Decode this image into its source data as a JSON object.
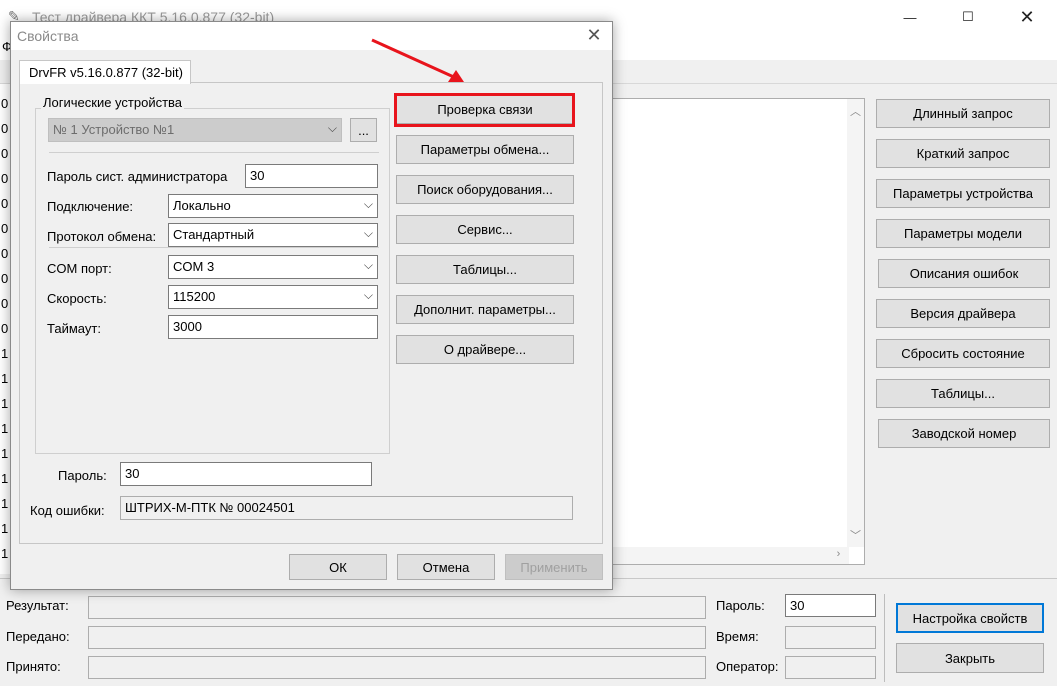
{
  "main_window": {
    "title": "Тест драйвера ККТ 5.16.0.877 (32-bit)",
    "menu_first_letter": "Ф",
    "gutter_numbers": [
      "0",
      "0",
      "0",
      "0",
      "0",
      "0",
      "0",
      "0",
      "0",
      "0",
      "1",
      "1",
      "1",
      "1",
      "1",
      "1",
      "1",
      "1",
      "1"
    ],
    "right_buttons": [
      "Длинный запрос",
      "Краткий запрос",
      "Параметры устройства",
      "Параметры модели",
      "Описания ошибок",
      "Версия драйвера",
      "Сбросить состояние",
      "Таблицы...",
      "Заводской номер"
    ],
    "bottom": {
      "result_label": "Результат:",
      "sent_label": "Передано:",
      "received_label": "Принято:",
      "password_label": "Пароль:",
      "password_value": "30",
      "time_label": "Время:",
      "operator_label": "Оператор:",
      "settings_button": "Настройка свойств",
      "close_button": "Закрыть"
    }
  },
  "dialog": {
    "title": "Свойства",
    "tab_label": "DrvFR v5.16.0.877 (32-bit)",
    "group_title": "Логические устройства",
    "device_select": "№ 1 Устройство №1",
    "ellipsis_button": "...",
    "admin_password_label": "Пароль сист. администратора",
    "admin_password_value": "30",
    "connection_label": "Подключение:",
    "connection_value": "Локально",
    "protocol_label": "Протокол обмена:",
    "protocol_value": "Стандартный",
    "com_label": "COM порт:",
    "com_value": "COM 3",
    "speed_label": "Скорость:",
    "speed_value": "115200",
    "timeout_label": "Таймаут:",
    "timeout_value": "3000",
    "password_label": "Пароль:",
    "password_value": "30",
    "error_code_label": "Код ошибки:",
    "error_code_value": "ШТРИХ-М-ПТК № 00024501",
    "action_buttons": [
      "Проверка связи",
      "Параметры обмена...",
      "Поиск оборудования...",
      "Сервис...",
      "Таблицы...",
      "Дополнит. параметры...",
      "О драйвере..."
    ],
    "ok_button": "ОК",
    "cancel_button": "Отмена",
    "apply_button": "Применить"
  },
  "annotation": {
    "highlight_color": "#e8141c",
    "arrow_color": "#e8141c"
  }
}
